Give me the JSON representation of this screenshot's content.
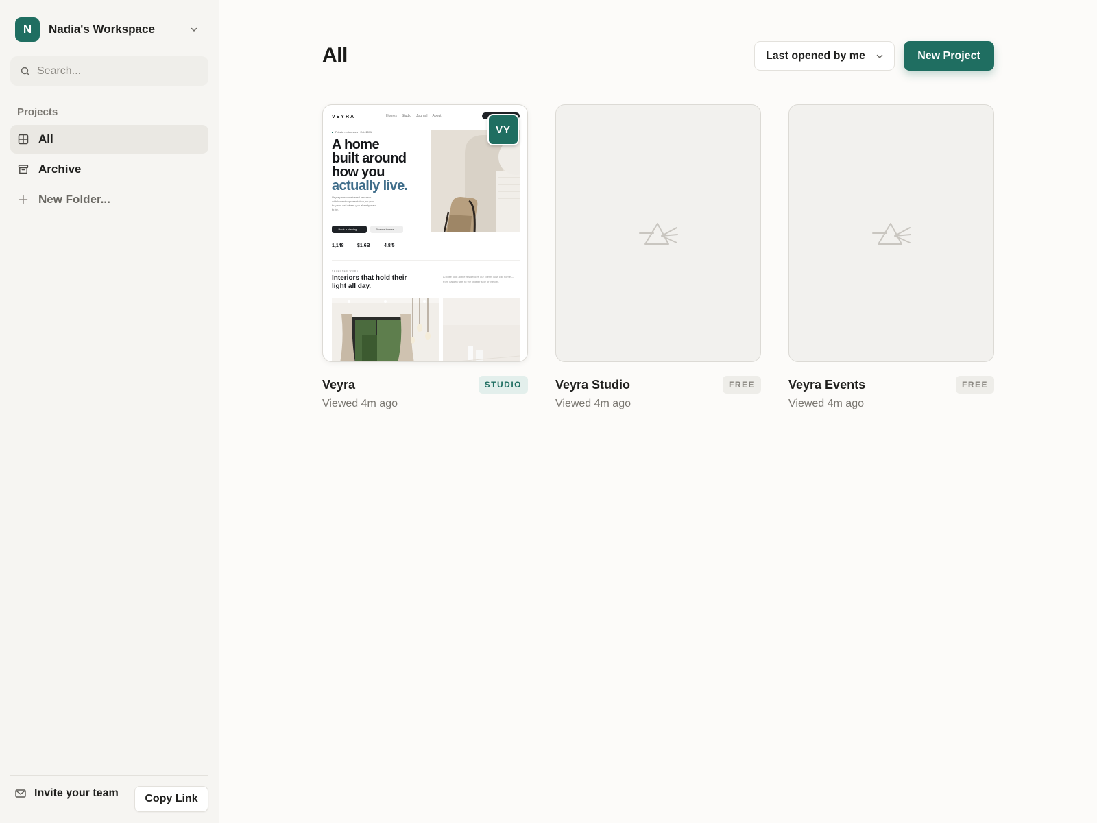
{
  "workspace": {
    "initial": "N",
    "name": "Nadia's Workspace"
  },
  "search": {
    "placeholder": "Search..."
  },
  "sidebar": {
    "section_label": "Projects",
    "items": [
      {
        "label": "All",
        "icon": "grid-icon",
        "active": true
      },
      {
        "label": "Archive",
        "icon": "archive-icon",
        "active": false
      },
      {
        "label": "New Folder...",
        "icon": "plus-icon",
        "active": false
      }
    ],
    "footer": {
      "invite_label": "Invite your team",
      "copy_link_label": "Copy Link"
    }
  },
  "main": {
    "title": "All",
    "sort_label": "Last opened by me",
    "new_project_label": "New Project"
  },
  "projects": [
    {
      "name": "Veyra",
      "badge": "STUDIO",
      "meta": "Viewed 4m ago",
      "avatar": "VY"
    },
    {
      "name": "Veyra Studio",
      "badge": "FREE",
      "meta": "Viewed 4m ago"
    },
    {
      "name": "Veyra Events",
      "badge": "FREE",
      "meta": "Viewed 4m ago"
    }
  ],
  "preview": {
    "logo": "VEYRA",
    "nav": [
      "Homes",
      "Studio",
      "Journal",
      "About"
    ],
    "eyebrow": "Private residences · Est. 2011",
    "headline_lines": [
      "A home",
      "built around",
      "how you"
    ],
    "headline_accent": "actually live.",
    "body": "Veyra pairs considered research with honest representation, so you buy and sell where you already want to be.",
    "btn_primary": "Book a viewing →",
    "btn_secondary": "Browse homes →",
    "stats": [
      "1,148",
      "$1.6B",
      "4.8/5"
    ],
    "section_eyebrow": "SELECTED WORK",
    "section_title": "Interiors that hold their light all day.",
    "section_note": "A close look at the residences our clients now call home — from garden flats to the quieter side of the city."
  },
  "colors": {
    "accent": "#1f6e61",
    "sidebar_bg": "#f6f5f2",
    "page_bg": "#fcfbf9",
    "headline_accent": "#3f6d8a"
  }
}
